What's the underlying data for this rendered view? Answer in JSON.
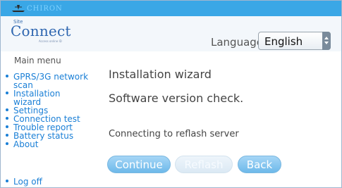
{
  "brand": {
    "name": "CHIRON"
  },
  "logo": {
    "small": "Site",
    "main": "Connect",
    "tagline": "Access online ID"
  },
  "language": {
    "label": "Language:",
    "selected": "English"
  },
  "menu": {
    "title": "Main menu",
    "items": [
      {
        "label": "GPRS/3G network",
        "label2": "scan"
      },
      {
        "label": "Installation",
        "label2": "wizard"
      },
      {
        "label": "Settings"
      },
      {
        "label": "Connection test"
      },
      {
        "label": "Trouble report"
      },
      {
        "label": "Battery status"
      },
      {
        "label": "About"
      }
    ],
    "logoff": "Log off"
  },
  "wizard": {
    "title": "Installation wizard",
    "subtitle": "Software version check.",
    "status": "Connecting to reflash server"
  },
  "buttons": {
    "continue": "Continue",
    "reflash": "Reflash",
    "back": "Back"
  },
  "colors": {
    "topbar": "#3aa7e6",
    "link": "#1a7fd6",
    "button": "#6db9ea"
  }
}
